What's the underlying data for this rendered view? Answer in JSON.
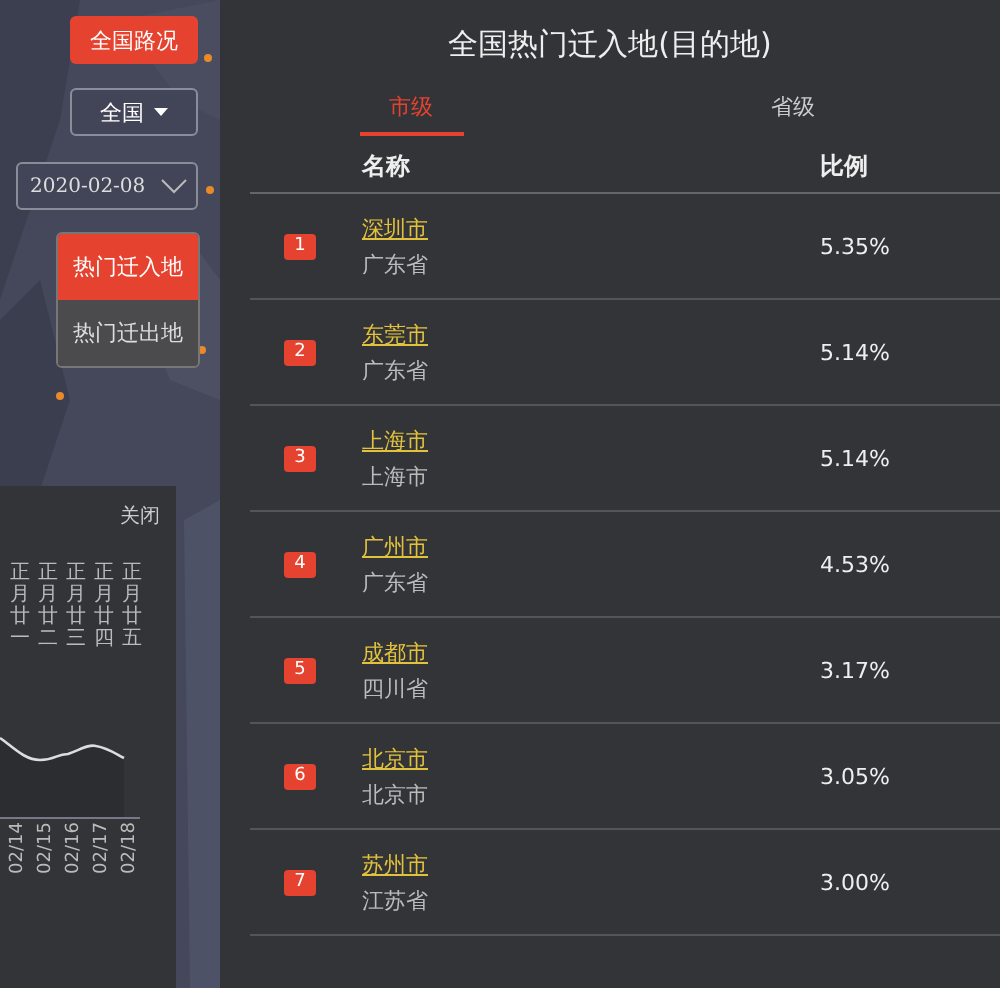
{
  "map_controls": {
    "traffic_button": "全国路况",
    "region_select": {
      "value": "全国"
    },
    "date_field": {
      "value": "2020-02-08"
    },
    "direction_tabs": [
      {
        "label": "热门迁入地",
        "selected": true
      },
      {
        "label": "热门迁出地",
        "selected": false
      }
    ]
  },
  "trend_panel": {
    "close": "关闭",
    "lunar_labels": [
      "正月廿一",
      "正月廿二",
      "正月廿三",
      "正月廿四",
      "正月廿五"
    ],
    "dates": [
      "02/14",
      "02/15",
      "02/16",
      "02/17",
      "02/18"
    ]
  },
  "ranking": {
    "title": "全国热门迁入地(目的地)",
    "tabs": [
      {
        "label": "市级",
        "selected": true
      },
      {
        "label": "省级",
        "selected": false
      }
    ],
    "columns": [
      "名称",
      "比例"
    ],
    "rows": [
      {
        "rank": "1",
        "city": "深圳市",
        "province": "广东省",
        "share": "5.35%"
      },
      {
        "rank": "2",
        "city": "东莞市",
        "province": "广东省",
        "share": "5.14%"
      },
      {
        "rank": "3",
        "city": "上海市",
        "province": "上海市",
        "share": "5.14%"
      },
      {
        "rank": "4",
        "city": "广州市",
        "province": "广东省",
        "share": "4.53%"
      },
      {
        "rank": "5",
        "city": "成都市",
        "province": "四川省",
        "share": "3.17%"
      },
      {
        "rank": "6",
        "city": "北京市",
        "province": "北京市",
        "share": "3.05%"
      },
      {
        "rank": "7",
        "city": "苏州市",
        "province": "江苏省",
        "share": "3.00%"
      }
    ]
  }
}
